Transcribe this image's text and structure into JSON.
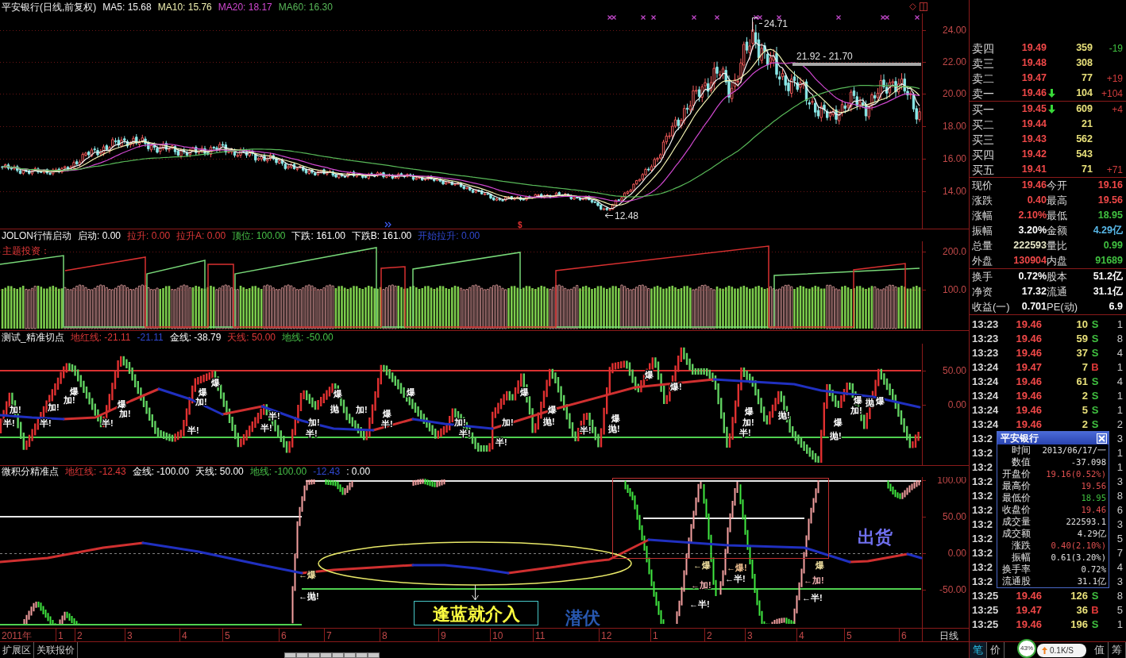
{
  "price_panel": {
    "title": "平安银行(日线,前复权)",
    "indicators": [
      {
        "text": "MA5: 15.68",
        "color": "#f0f0f0"
      },
      {
        "text": "MA10: 15.76",
        "color": "#f0f0b0"
      },
      {
        "text": "MA20: 18.17",
        "color": "#d048d0"
      },
      {
        "text": "MA60: 16.30",
        "color": "#58b858"
      }
    ],
    "axis_labels": [
      "24.00",
      "22.00",
      "20.00",
      "18.00",
      "16.00",
      "14.00"
    ],
    "annotations": [
      "24.71",
      "21.92 - 21.70",
      "12.48"
    ],
    "event_mark": "$"
  },
  "jolon_panel": {
    "title": "JOLON行情启动",
    "indicators": [
      {
        "text": "启动: 0.00"
      },
      {
        "text": "拉升: 0.00",
        "color": "#e03838"
      },
      {
        "text": "拉升A: 0.00",
        "color": "#e03838"
      },
      {
        "text": "顶位: 100.00",
        "color": "#48c048"
      },
      {
        "text": "下跌: 161.00"
      },
      {
        "text": "下跌B: 161.00"
      },
      {
        "text": "开始拉升: 0.00",
        "color": "#3048d0"
      }
    ],
    "legend": "主题投资：",
    "axis_labels": [
      "200.0",
      "100.0"
    ]
  },
  "cut_point_panel": {
    "title": "测试_精准切点",
    "indicators": [
      {
        "text": "地红线: -21.11",
        "color": "#e03838"
      },
      {
        "text": "-21.11",
        "color": "#3048d0"
      },
      {
        "text": "金线: -38.79"
      },
      {
        "text": "天线: 50.00",
        "color": "#e03838"
      },
      {
        "text": "地线: -50.00",
        "color": "#48c048"
      }
    ],
    "axis_labels": [
      "50.00",
      "0.00"
    ],
    "signals": [
      "加!",
      "半!",
      "加!",
      "半!",
      "加!",
      "爆",
      "爆",
      "加!",
      "半!",
      "爆",
      "加!",
      "爆",
      "半!",
      "半!",
      "半!",
      "加!",
      "半!",
      "爆",
      "抛",
      "加!",
      "爆",
      "半!",
      "爆",
      "加!",
      "半!",
      "加!",
      "半!",
      "爆",
      "爆",
      "抛!",
      "半!",
      "爆",
      "抛!",
      "爆",
      "爆!",
      "爆",
      "加!",
      "半!",
      "抛!",
      "爆",
      "抛!",
      "爆",
      "加!",
      "抛",
      "爆"
    ]
  },
  "integral_panel": {
    "title": "微积分精准点",
    "indicators": [
      {
        "text": "地红线: -12.43",
        "color": "#e03838"
      },
      {
        "text": "金线: -100.00"
      },
      {
        "text": "天线: 50.00"
      },
      {
        "text": "地线: -100.00",
        "color": "#48c048"
      },
      {
        "text": "-12.43",
        "color": "#3048d0"
      },
      {
        "text": ": 0.00"
      }
    ],
    "axis_labels": [
      "100.00",
      "50.00",
      "0.00",
      "-50.00"
    ],
    "signals": [
      {
        "text": "←爆",
        "color": "#f0e0a0"
      },
      {
        "text": "←抛!",
        "color": "#ffffff"
      },
      {
        "text": "←爆",
        "color": "#f0e0a0"
      },
      {
        "text": "←加!",
        "color": "#f0b0b0"
      },
      {
        "text": "←半!",
        "color": "#ffffff"
      },
      {
        "text": "←爆!",
        "color": "#f0c090"
      },
      {
        "text": "←半!",
        "color": "#ffffff"
      },
      {
        "text": "爆",
        "color": "#f0e0a0"
      },
      {
        "text": "←加!",
        "color": "#f0b0b0"
      },
      {
        "text": "←半!",
        "color": "#ffffff"
      }
    ],
    "notes": [
      {
        "text": "逢蓝就介入",
        "kind": "callout",
        "color": "#ffff40"
      },
      {
        "text": "潜伏",
        "kind": "plain",
        "color": "#2858b0"
      },
      {
        "text": "出货",
        "kind": "plain",
        "color": "#7070f0"
      }
    ]
  },
  "time_axis": {
    "labels": [
      "2011年",
      "1",
      "2",
      "3",
      "4",
      "5",
      "6",
      "7",
      "8",
      "9",
      "10",
      "11",
      "12",
      "1",
      "2",
      "3",
      "4",
      "5",
      "6"
    ],
    "period": "日线"
  },
  "bottom_tabs": [
    "扩展区",
    "关联报价"
  ],
  "quote": {
    "asks": [
      {
        "label": "卖四",
        "price": "19.49",
        "down_arrow": false,
        "volume": "359",
        "change": {
          "text": "-19",
          "color": "#40c040"
        }
      },
      {
        "label": "卖三",
        "price": "19.48",
        "down_arrow": false,
        "volume": "308"
      },
      {
        "label": "卖二",
        "price": "19.47",
        "down_arrow": false,
        "volume": "77",
        "change": {
          "text": "+19",
          "color": "#d03c3c"
        }
      },
      {
        "label": "卖一",
        "price": "19.46",
        "down_arrow": true,
        "volume": "104",
        "change": {
          "text": "+104",
          "color": "#d03c3c"
        }
      }
    ],
    "bids": [
      {
        "label": "买一",
        "price": "19.45",
        "down_arrow": true,
        "volume": "609",
        "change": {
          "text": "+4",
          "color": "#d03c3c"
        }
      },
      {
        "label": "买二",
        "price": "19.44",
        "down_arrow": false,
        "volume": "21"
      },
      {
        "label": "买三",
        "price": "19.43",
        "down_arrow": false,
        "volume": "562"
      },
      {
        "label": "买四",
        "price": "19.42",
        "down_arrow": false,
        "volume": "543"
      },
      {
        "label": "买五",
        "price": "19.41",
        "down_arrow": false,
        "volume": "71",
        "change": {
          "text": "+71",
          "color": "#d03c3c"
        }
      }
    ],
    "stats": [
      {
        "label": "现价",
        "value": "19.46",
        "color": "#f04848"
      },
      {
        "label": "今开",
        "value": "19.16",
        "color": "#f04848"
      },
      {
        "label": "涨跌",
        "value": "0.40",
        "color": "#f04848"
      },
      {
        "label": "最高",
        "value": "19.56",
        "color": "#f04848"
      },
      {
        "label": "涨幅",
        "value": "2.10%",
        "color": "#f04848"
      },
      {
        "label": "最低",
        "value": "18.95",
        "color": "#40c040"
      },
      {
        "label": "振幅",
        "value": "3.20%"
      },
      {
        "label": "金额",
        "value": "4.29亿",
        "color": "#58b8e8"
      },
      {
        "label": "总量",
        "value": "222593",
        "color": "#e8e8c8"
      },
      {
        "label": "量比",
        "value": "0.99",
        "color": "#40c040"
      },
      {
        "label": "外盘",
        "value": "130904",
        "color": "#f04848"
      },
      {
        "label": "内盘",
        "value": "91689",
        "color": "#40c040"
      }
    ],
    "more_stats": [
      {
        "label": "换手",
        "value": "0.72%"
      },
      {
        "label": "股本",
        "value": "51.2亿"
      },
      {
        "label": "净资",
        "value": "17.32"
      },
      {
        "label": "流通",
        "value": "31.1亿"
      },
      {
        "label": "收益(一)",
        "value": "0.701"
      },
      {
        "label": "PE(动)",
        "value": "6.9"
      }
    ],
    "ticks": [
      {
        "time": "13:23",
        "price": "19.46",
        "volume": "10",
        "side": "S",
        "kind": "sell",
        "count": "1"
      },
      {
        "time": "13:23",
        "price": "19.46",
        "volume": "59",
        "side": "S",
        "kind": "sell",
        "count": "8"
      },
      {
        "time": "13:23",
        "price": "19.46",
        "volume": "37",
        "side": "S",
        "kind": "sell",
        "count": "4"
      },
      {
        "time": "13:24",
        "price": "19.47",
        "volume": "7",
        "side": "B",
        "kind": "buy",
        "count": "1"
      },
      {
        "time": "13:24",
        "price": "19.46",
        "volume": "61",
        "side": "S",
        "kind": "sell",
        "count": "4"
      },
      {
        "time": "13:24",
        "price": "19.46",
        "volume": "2",
        "side": "S",
        "kind": "sell",
        "count": "1"
      },
      {
        "time": "13:24",
        "price": "19.46",
        "volume": "5",
        "side": "S",
        "kind": "sell",
        "count": "1"
      },
      {
        "time": "13:24",
        "price": "19.46",
        "volume": "2",
        "side": "S",
        "kind": "sell",
        "count": "2"
      },
      {
        "time": "13:2",
        "count": "3"
      },
      {
        "time": "13:2",
        "count": "1"
      },
      {
        "time": "13:2",
        "count": "1"
      },
      {
        "time": "13:2",
        "count": "3"
      },
      {
        "time": "13:2",
        "count": "8"
      },
      {
        "time": "13:2",
        "count": "6"
      },
      {
        "time": "13:2",
        "count": "3"
      },
      {
        "time": "13:2",
        "count": "5"
      },
      {
        "time": "13:2",
        "count": "7"
      },
      {
        "time": "13:2",
        "count": "4"
      },
      {
        "time": "13:2",
        "count": "3"
      },
      {
        "time": "13:25",
        "price": "19.46",
        "volume": "126",
        "side": "S",
        "kind": "sell",
        "count": "8"
      },
      {
        "time": "13:25",
        "price": "19.47",
        "volume": "36",
        "side": "B",
        "kind": "buy",
        "count": "5"
      },
      {
        "time": "13:25",
        "price": "19.46",
        "volume": "196",
        "side": "S",
        "kind": "sell",
        "count": "1"
      }
    ]
  },
  "popup": {
    "title": "平安银行",
    "rows": [
      {
        "label": "时间",
        "value": "2013/06/17/一"
      },
      {
        "label": "数值",
        "value": "-37.098"
      },
      {
        "label": "开盘价",
        "value": "19.16(0.52%)",
        "color": "#e05050"
      },
      {
        "label": "最高价",
        "value": "19.56",
        "color": "#e05050"
      },
      {
        "label": "最低价",
        "value": "18.95",
        "color": "#40c040"
      },
      {
        "label": "收盘价",
        "value": "19.46",
        "color": "#e05050"
      },
      {
        "label": "成交量",
        "value": "222593.1"
      },
      {
        "label": "成交额",
        "value": "4.29亿"
      },
      {
        "label": "涨跌",
        "value": "0.40(2.10%)",
        "color": "#e05050"
      },
      {
        "label": "振幅",
        "value": "0.61(3.20%)"
      },
      {
        "label": "换手率",
        "value": "0.72%"
      },
      {
        "label": "流通股",
        "value": "31.1亿"
      }
    ]
  },
  "detail_tabs": [
    {
      "label": "笔",
      "selected": true
    },
    {
      "label": "价",
      "selected": false
    },
    {
      "label": "值",
      "selected": false
    },
    {
      "label": "筹",
      "selected": false
    }
  ],
  "speed_widget": {
    "percent": "43%",
    "speed": "0.1K/S"
  }
}
